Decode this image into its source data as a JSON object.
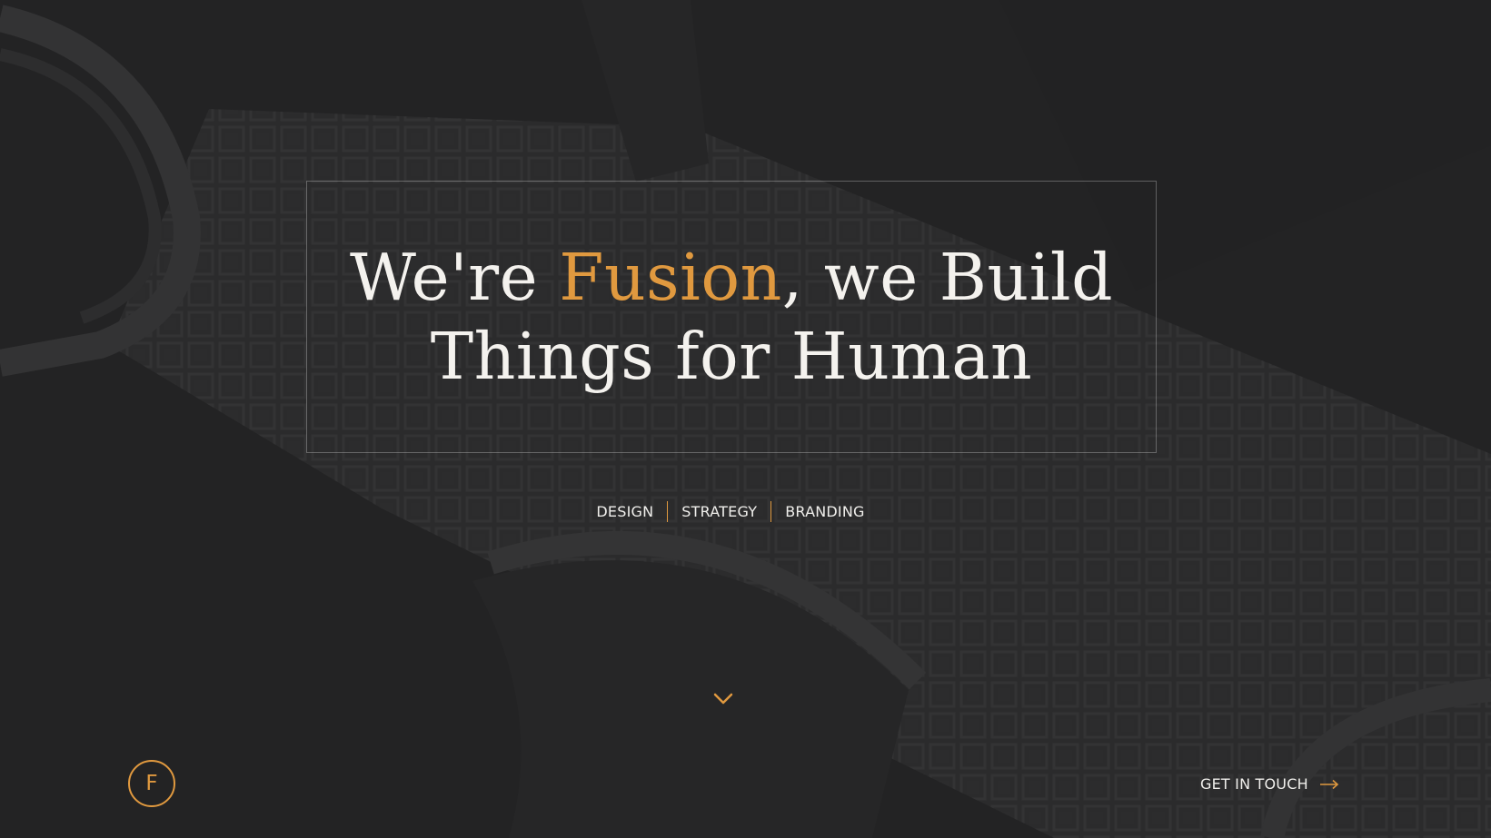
{
  "hero": {
    "line1_prefix": "We're ",
    "line1_accent": "Fusion",
    "line1_suffix": ", we Build",
    "line2": "Things for Human"
  },
  "services": [
    "DESIGN",
    "STRATEGY",
    "BRANDING"
  ],
  "scroll": {
    "icon": "chevron-down-icon"
  },
  "logo": {
    "letter": "F"
  },
  "cta": {
    "label": "GET IN TOUCH",
    "icon": "arrow-right-icon"
  },
  "colors": {
    "background": "#232324",
    "accent": "#e0993f",
    "text": "#f4f2ee"
  }
}
